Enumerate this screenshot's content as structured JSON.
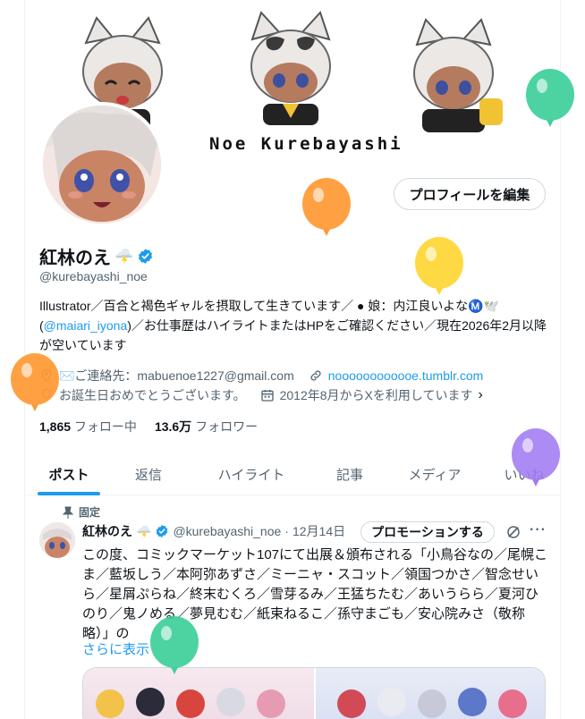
{
  "banner": {
    "name": "Noe Kurebayashi"
  },
  "profile": {
    "display_name": "紅林のえ",
    "name_emoji": "🌩️",
    "handle": "@kurebayashi_noe",
    "edit_button": "プロフィールを編集",
    "bio_1": "Illustrator／百合と褐色ギャルを摂取して生きています／ ● 娘：内江良いよな",
    "bio_emoji": "Ⓜ️🕊️",
    "bio_paren": "(",
    "bio_link": "@maiari_iyona",
    "bio_2": ")／お仕事歴はハイライトまたはHPをご確認ください／現在2026年2月以降が空いています",
    "contact": "✉️ご連絡先：mabuenoe1227@gmail.com",
    "website": "noooooooooooe.tumblr.com",
    "birthday": "お誕生日おめでとうございます。",
    "joined": "2012年8月からXを利用しています",
    "following_count": "1,865",
    "following_label": "フォロー中",
    "followers_count": "13.6万",
    "followers_label": "フォロワー"
  },
  "tabs": [
    {
      "label": "ポスト",
      "active": true
    },
    {
      "label": "返信"
    },
    {
      "label": "ハイライト"
    },
    {
      "label": "記事"
    },
    {
      "label": "メディア"
    },
    {
      "label": "いいね"
    }
  ],
  "tweet": {
    "pinned_label": "固定",
    "author": "紅林のえ",
    "author_emoji": "🌩️",
    "handle": "@kurebayashi_noe",
    "separator": "·",
    "date": "12月14日",
    "promo_button": "プロモーションする",
    "more": "···",
    "text": "この度、コミックマーケット107にて出展＆頒布される「小鳥谷なの／尾幌こま／藍坂しう／本阿弥あずさ／ミーニャ・スコット／領国つかさ／智念せいら／星屑ぷらね／終末むくろ／雪芽るみ／王猛ちたむ／あいうらら／夏河ひのり／鬼ノめる／夢見むむ／紙束ねるこ／孫守まごも／安心院みさ（敬称略）」の",
    "show_more": "さらに表示"
  },
  "colors": {
    "accent": "#1d9bf0",
    "text": "#0f1419",
    "muted": "#536471",
    "border": "#cfd9de"
  },
  "balloons": [
    "green",
    "orange",
    "yellow",
    "orange",
    "purple",
    "green"
  ]
}
